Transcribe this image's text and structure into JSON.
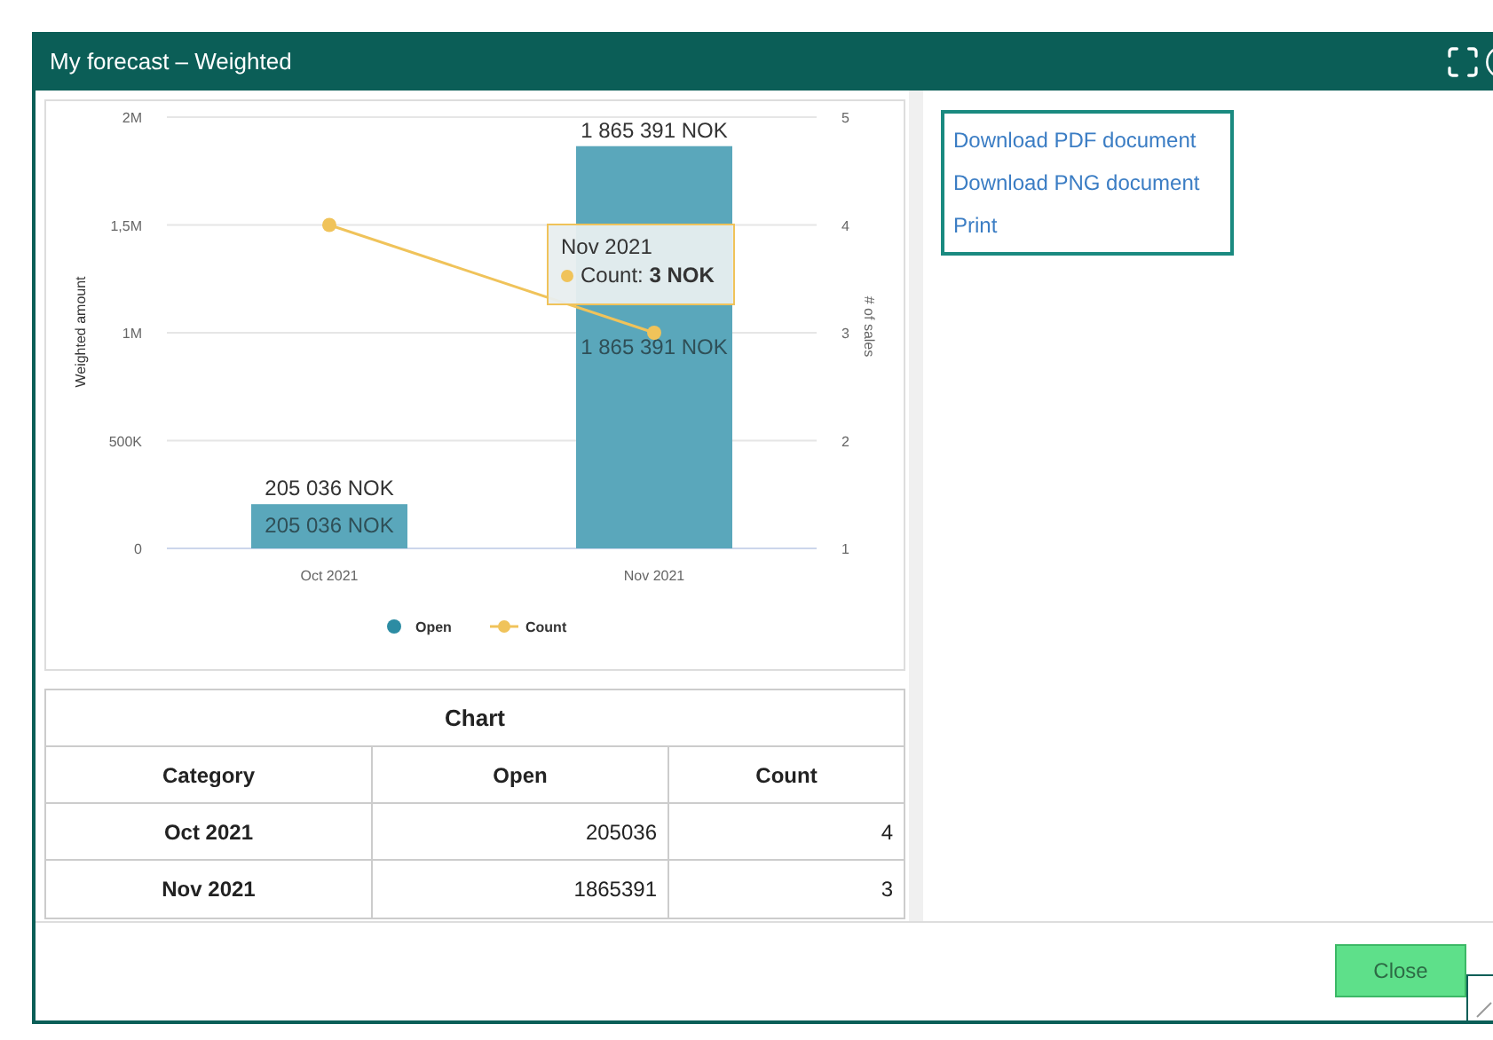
{
  "window": {
    "title": "My forecast – Weighted"
  },
  "chart_panel": {
    "chart_data": {
      "type": "bar",
      "grid": true,
      "ylabel": "Weighted amount",
      "y2label": "# of sales",
      "categories": [
        "Oct 2021",
        "Nov 2021"
      ],
      "series": [
        {
          "name": "Open",
          "color": "#5aa7bb",
          "values": [
            205036,
            1865391
          ]
        },
        {
          "name": "Count",
          "color": "#f0c35a",
          "values": [
            4,
            3
          ]
        }
      ],
      "ylim": [
        0,
        2000000
      ],
      "yticks": [
        {
          "value": 0,
          "label": "0"
        },
        {
          "value": 500000,
          "label": "500K"
        },
        {
          "value": 1000000,
          "label": "1M"
        },
        {
          "value": 1500000,
          "label": "1,5M"
        },
        {
          "value": 2000000,
          "label": "2M"
        }
      ],
      "y2lim": [
        1,
        5
      ],
      "y2ticks": [
        {
          "value": 1,
          "label": "1"
        },
        {
          "value": 2,
          "label": "2"
        },
        {
          "value": 3,
          "label": "3"
        },
        {
          "value": 4,
          "label": "4"
        },
        {
          "value": 5,
          "label": "5"
        }
      ],
      "value_labels": [
        {
          "above": "205 036 NOK",
          "inside": "205 036 NOK"
        },
        {
          "above": "1 865 391 NOK",
          "inside": "1 865 391 NOK"
        }
      ]
    },
    "tooltip": {
      "title": "Nov 2021",
      "text": "Count: **3 NOK**"
    }
  },
  "table": {
    "title": "Chart",
    "columns": [
      "Category",
      "Open",
      "Count"
    ],
    "rows": [
      [
        "Oct 2021",
        "205036",
        "4"
      ],
      [
        "Nov 2021",
        "1865391",
        "3"
      ]
    ]
  },
  "export_menu": [
    "Download PDF document",
    "Download PNG document",
    "Print"
  ],
  "buttons": [
    "Close"
  ]
}
